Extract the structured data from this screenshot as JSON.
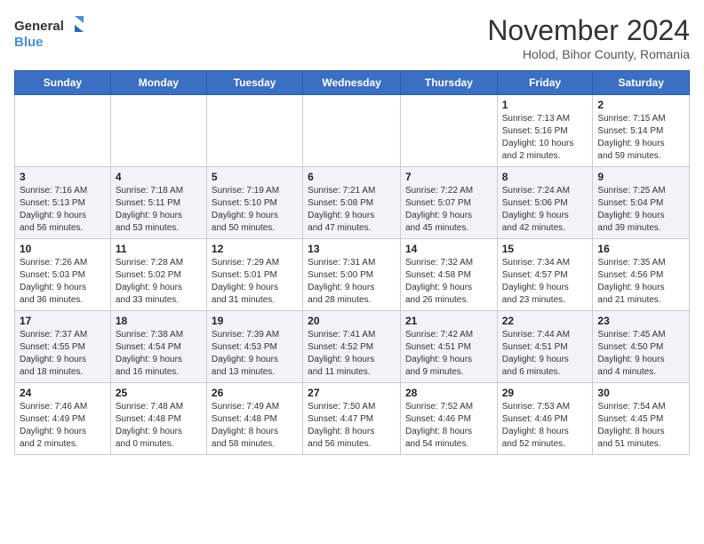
{
  "logo": {
    "line1": "General",
    "line2": "Blue"
  },
  "title": "November 2024",
  "location": "Holod, Bihor County, Romania",
  "weekdays": [
    "Sunday",
    "Monday",
    "Tuesday",
    "Wednesday",
    "Thursday",
    "Friday",
    "Saturday"
  ],
  "weeks": [
    [
      {
        "day": "",
        "info": ""
      },
      {
        "day": "",
        "info": ""
      },
      {
        "day": "",
        "info": ""
      },
      {
        "day": "",
        "info": ""
      },
      {
        "day": "",
        "info": ""
      },
      {
        "day": "1",
        "info": "Sunrise: 7:13 AM\nSunset: 5:16 PM\nDaylight: 10 hours\nand 2 minutes."
      },
      {
        "day": "2",
        "info": "Sunrise: 7:15 AM\nSunset: 5:14 PM\nDaylight: 9 hours\nand 59 minutes."
      }
    ],
    [
      {
        "day": "3",
        "info": "Sunrise: 7:16 AM\nSunset: 5:13 PM\nDaylight: 9 hours\nand 56 minutes."
      },
      {
        "day": "4",
        "info": "Sunrise: 7:18 AM\nSunset: 5:11 PM\nDaylight: 9 hours\nand 53 minutes."
      },
      {
        "day": "5",
        "info": "Sunrise: 7:19 AM\nSunset: 5:10 PM\nDaylight: 9 hours\nand 50 minutes."
      },
      {
        "day": "6",
        "info": "Sunrise: 7:21 AM\nSunset: 5:08 PM\nDaylight: 9 hours\nand 47 minutes."
      },
      {
        "day": "7",
        "info": "Sunrise: 7:22 AM\nSunset: 5:07 PM\nDaylight: 9 hours\nand 45 minutes."
      },
      {
        "day": "8",
        "info": "Sunrise: 7:24 AM\nSunset: 5:06 PM\nDaylight: 9 hours\nand 42 minutes."
      },
      {
        "day": "9",
        "info": "Sunrise: 7:25 AM\nSunset: 5:04 PM\nDaylight: 9 hours\nand 39 minutes."
      }
    ],
    [
      {
        "day": "10",
        "info": "Sunrise: 7:26 AM\nSunset: 5:03 PM\nDaylight: 9 hours\nand 36 minutes."
      },
      {
        "day": "11",
        "info": "Sunrise: 7:28 AM\nSunset: 5:02 PM\nDaylight: 9 hours\nand 33 minutes."
      },
      {
        "day": "12",
        "info": "Sunrise: 7:29 AM\nSunset: 5:01 PM\nDaylight: 9 hours\nand 31 minutes."
      },
      {
        "day": "13",
        "info": "Sunrise: 7:31 AM\nSunset: 5:00 PM\nDaylight: 9 hours\nand 28 minutes."
      },
      {
        "day": "14",
        "info": "Sunrise: 7:32 AM\nSunset: 4:58 PM\nDaylight: 9 hours\nand 26 minutes."
      },
      {
        "day": "15",
        "info": "Sunrise: 7:34 AM\nSunset: 4:57 PM\nDaylight: 9 hours\nand 23 minutes."
      },
      {
        "day": "16",
        "info": "Sunrise: 7:35 AM\nSunset: 4:56 PM\nDaylight: 9 hours\nand 21 minutes."
      }
    ],
    [
      {
        "day": "17",
        "info": "Sunrise: 7:37 AM\nSunset: 4:55 PM\nDaylight: 9 hours\nand 18 minutes."
      },
      {
        "day": "18",
        "info": "Sunrise: 7:38 AM\nSunset: 4:54 PM\nDaylight: 9 hours\nand 16 minutes."
      },
      {
        "day": "19",
        "info": "Sunrise: 7:39 AM\nSunset: 4:53 PM\nDaylight: 9 hours\nand 13 minutes."
      },
      {
        "day": "20",
        "info": "Sunrise: 7:41 AM\nSunset: 4:52 PM\nDaylight: 9 hours\nand 11 minutes."
      },
      {
        "day": "21",
        "info": "Sunrise: 7:42 AM\nSunset: 4:51 PM\nDaylight: 9 hours\nand 9 minutes."
      },
      {
        "day": "22",
        "info": "Sunrise: 7:44 AM\nSunset: 4:51 PM\nDaylight: 9 hours\nand 6 minutes."
      },
      {
        "day": "23",
        "info": "Sunrise: 7:45 AM\nSunset: 4:50 PM\nDaylight: 9 hours\nand 4 minutes."
      }
    ],
    [
      {
        "day": "24",
        "info": "Sunrise: 7:46 AM\nSunset: 4:49 PM\nDaylight: 9 hours\nand 2 minutes."
      },
      {
        "day": "25",
        "info": "Sunrise: 7:48 AM\nSunset: 4:48 PM\nDaylight: 9 hours\nand 0 minutes."
      },
      {
        "day": "26",
        "info": "Sunrise: 7:49 AM\nSunset: 4:48 PM\nDaylight: 8 hours\nand 58 minutes."
      },
      {
        "day": "27",
        "info": "Sunrise: 7:50 AM\nSunset: 4:47 PM\nDaylight: 8 hours\nand 56 minutes."
      },
      {
        "day": "28",
        "info": "Sunrise: 7:52 AM\nSunset: 4:46 PM\nDaylight: 8 hours\nand 54 minutes."
      },
      {
        "day": "29",
        "info": "Sunrise: 7:53 AM\nSunset: 4:46 PM\nDaylight: 8 hours\nand 52 minutes."
      },
      {
        "day": "30",
        "info": "Sunrise: 7:54 AM\nSunset: 4:45 PM\nDaylight: 8 hours\nand 51 minutes."
      }
    ]
  ]
}
